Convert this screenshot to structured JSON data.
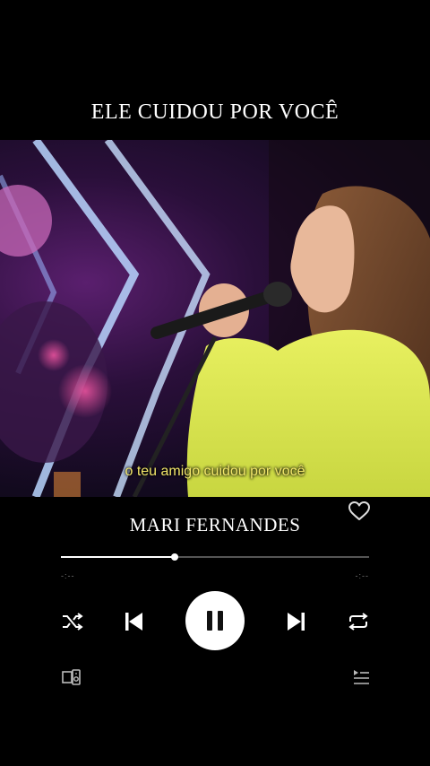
{
  "header": {
    "song_title": "ELE CUIDOU POR VOCÊ"
  },
  "video": {
    "subtitle": "o teu amigo cuidou por você"
  },
  "player": {
    "artist": "MARI FERNANDES",
    "progress": 0.37,
    "elapsed": "-:--",
    "remaining": "-:--",
    "controls": [
      "shuffle-icon",
      "previous-icon",
      "pause-icon",
      "next-icon",
      "repeat-icon"
    ],
    "footer_icons": [
      "connect-device-icon",
      "queue-icon"
    ],
    "accent_color": "#ffffff",
    "subtitle_color": "#f2e66a"
  }
}
